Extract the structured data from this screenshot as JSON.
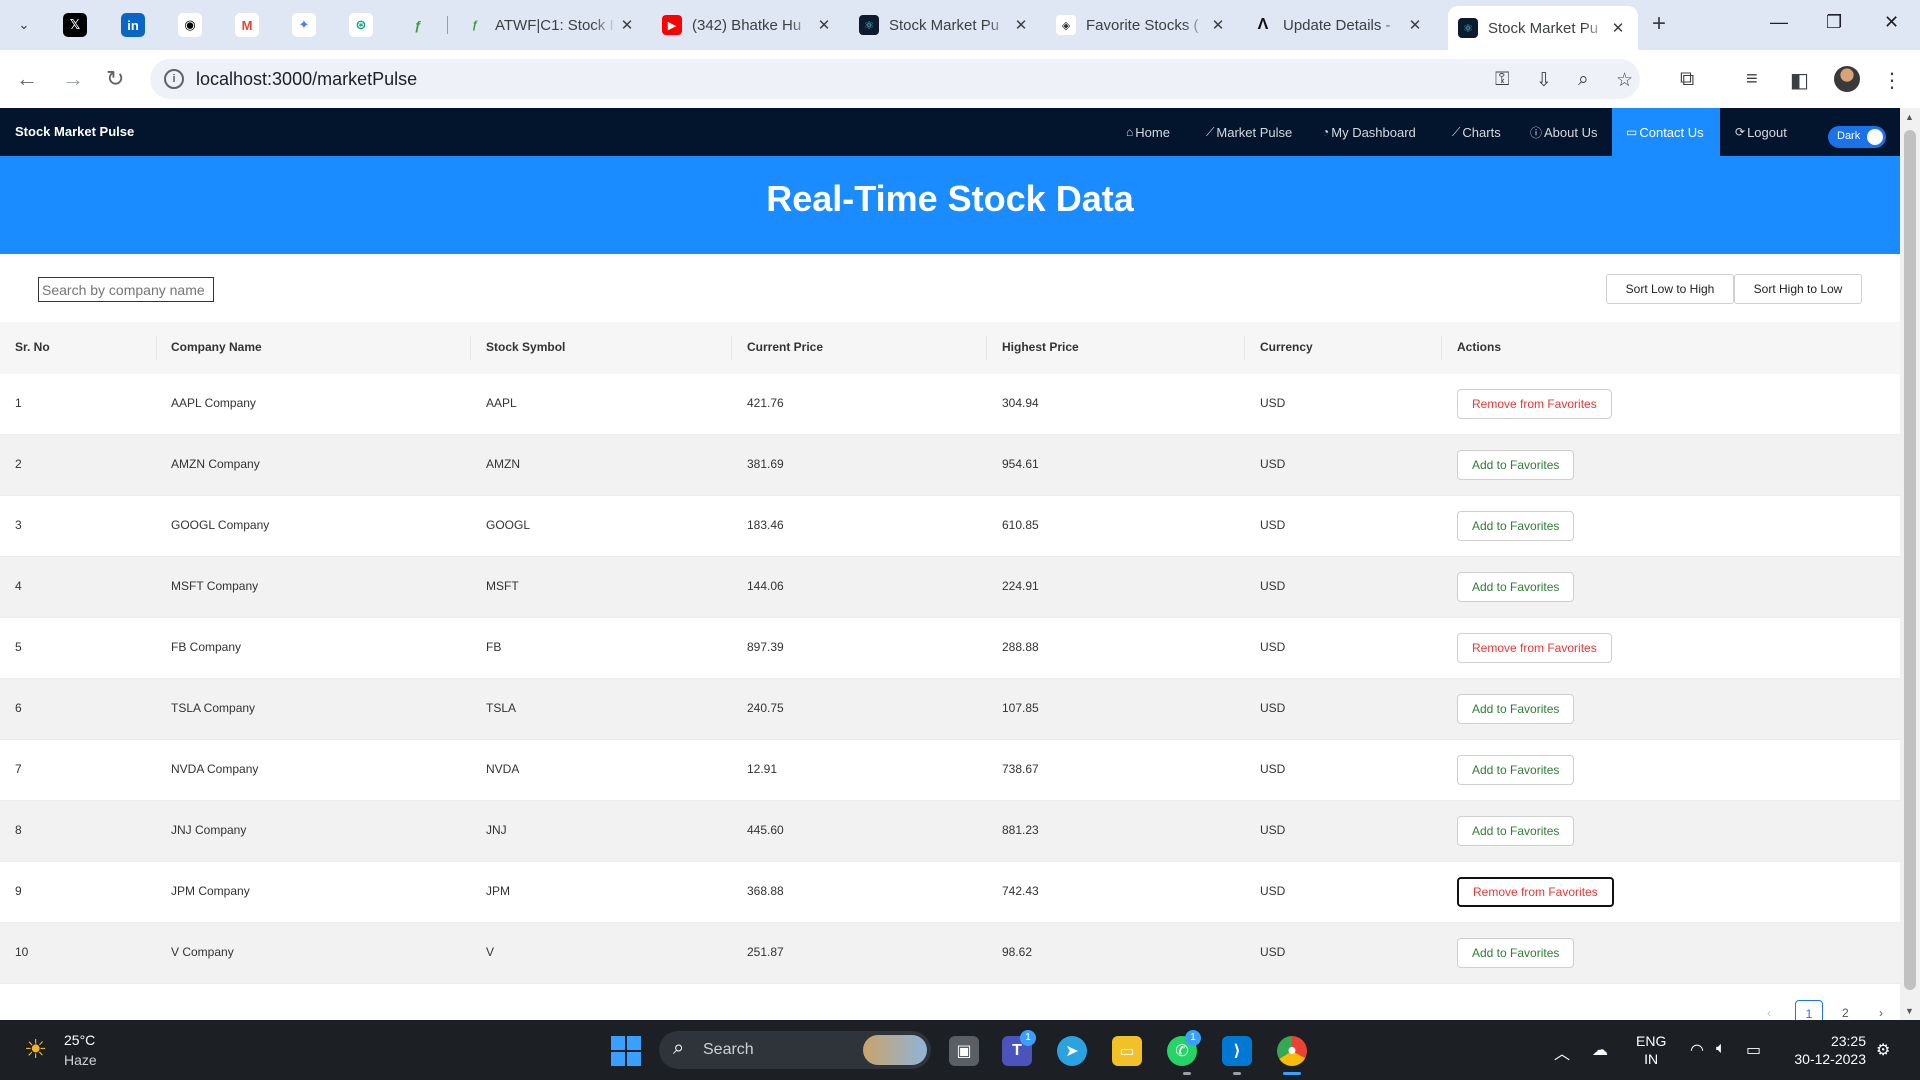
{
  "browser": {
    "tabs": [
      {
        "title": "ATWF|C1: Stock I",
        "icon": "green-feather-icon",
        "color": "#3c9a3c"
      },
      {
        "title": "(342) Bhatke Hu",
        "icon": "youtube-icon",
        "color": "#ff0000"
      },
      {
        "title": "Stock Market Pu",
        "icon": "react-icon",
        "color": "#0c1b2e"
      },
      {
        "title": "Favorite Stocks (",
        "icon": "code-cube-icon",
        "color": "#333333"
      },
      {
        "title": "Update Details -",
        "icon": "a-logo-icon",
        "color": "#111111"
      },
      {
        "title": "Stock Market Pu",
        "icon": "react-icon",
        "color": "#0c1b2e"
      }
    ],
    "url": "localhost:3000/marketPulse"
  },
  "app": {
    "brand": "Stock Market Pulse",
    "nav": [
      {
        "label": "Home",
        "icon": "⌂"
      },
      {
        "label": "Market Pulse",
        "icon": "⟋"
      },
      {
        "label": "My Dashboard",
        "icon": "◔"
      },
      {
        "label": "Charts",
        "icon": "⟋"
      },
      {
        "label": "About Us",
        "icon": "ⓘ"
      },
      {
        "label": "Contact Us",
        "icon": "▭"
      },
      {
        "label": "Logout",
        "icon": "⟳"
      }
    ],
    "theme_toggle": "Dark",
    "accent": "#1a8cff",
    "nav_bg": "#03142d"
  },
  "hero": {
    "title": "Real-Time Stock Data"
  },
  "controls": {
    "search_placeholder": "Search by company name",
    "sort_low": "Sort Low to High",
    "sort_high": "Sort High to Low"
  },
  "table": {
    "headers": [
      "Sr. No",
      "Company Name",
      "Stock Symbol",
      "Current Price",
      "Highest Price",
      "Currency",
      "Actions"
    ],
    "rows": [
      {
        "sr": "1",
        "company": "AAPL Company",
        "symbol": "AAPL",
        "current": "421.76",
        "highest": "304.94",
        "currency": "USD",
        "action": "Remove from Favorites"
      },
      {
        "sr": "2",
        "company": "AMZN Company",
        "symbol": "AMZN",
        "current": "381.69",
        "highest": "954.61",
        "currency": "USD",
        "action": "Add to Favorites"
      },
      {
        "sr": "3",
        "company": "GOOGL Company",
        "symbol": "GOOGL",
        "current": "183.46",
        "highest": "610.85",
        "currency": "USD",
        "action": "Add to Favorites"
      },
      {
        "sr": "4",
        "company": "MSFT Company",
        "symbol": "MSFT",
        "current": "144.06",
        "highest": "224.91",
        "currency": "USD",
        "action": "Add to Favorites"
      },
      {
        "sr": "5",
        "company": "FB Company",
        "symbol": "FB",
        "current": "897.39",
        "highest": "288.88",
        "currency": "USD",
        "action": "Remove from Favorites"
      },
      {
        "sr": "6",
        "company": "TSLA Company",
        "symbol": "TSLA",
        "current": "240.75",
        "highest": "107.85",
        "currency": "USD",
        "action": "Add to Favorites"
      },
      {
        "sr": "7",
        "company": "NVDA Company",
        "symbol": "NVDA",
        "current": "12.91",
        "highest": "738.67",
        "currency": "USD",
        "action": "Add to Favorites"
      },
      {
        "sr": "8",
        "company": "JNJ Company",
        "symbol": "JNJ",
        "current": "445.60",
        "highest": "881.23",
        "currency": "USD",
        "action": "Add to Favorites"
      },
      {
        "sr": "9",
        "company": "JPM Company",
        "symbol": "JPM",
        "current": "368.88",
        "highest": "742.43",
        "currency": "USD",
        "action": "Remove from Favorites"
      },
      {
        "sr": "10",
        "company": "V Company",
        "symbol": "V",
        "current": "251.87",
        "highest": "98.62",
        "currency": "USD",
        "action": "Add to Favorites"
      }
    ]
  },
  "pagination": {
    "prev": "‹",
    "pages": [
      "1",
      "2"
    ],
    "next": "›"
  },
  "taskbar": {
    "temp": "25°C",
    "condition": "Haze",
    "search": "Search",
    "lang_top": "ENG",
    "lang_bottom": "IN",
    "time": "23:25",
    "date": "30-12-2023",
    "teams_badge": "1",
    "whatsapp_badge": "1"
  }
}
